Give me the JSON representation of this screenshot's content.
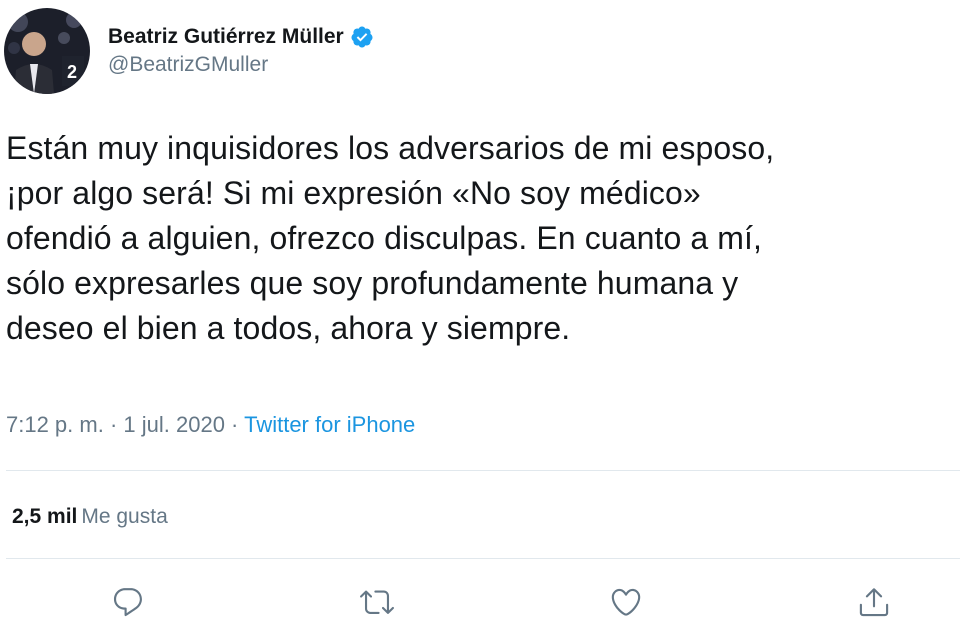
{
  "author": {
    "display_name": "Beatriz Gutiérrez Müller",
    "handle": "@BeatrizGMuller",
    "verified": true,
    "avatar_icon": "profile-photo"
  },
  "tweet": {
    "text": "Están muy inquisidores los adversarios de mi esposo,\n¡por algo será! Si mi expresión «No soy médico»\nofendió a alguien, ofrezco disculpas. En cuanto a mí,\nsólo expresarles que soy profundamente humana y\ndeseo el bien a todos, ahora y siempre.",
    "time": "7:12 p. m.",
    "separator1": " · ",
    "date": "1 jul. 2020",
    "separator2": " · ",
    "source": "Twitter for iPhone"
  },
  "stats": {
    "likes_count": "2,5 mil",
    "likes_label": "Me gusta"
  },
  "actions": {
    "reply_icon": "reply-icon",
    "retweet_icon": "retweet-icon",
    "like_icon": "like-icon",
    "share_icon": "share-icon"
  },
  "colors": {
    "text": "#14171a",
    "secondary": "#657786",
    "link": "#1b95e0",
    "verified": "#1da1f2",
    "divider": "#e1e8ed",
    "icon": "#657786"
  }
}
